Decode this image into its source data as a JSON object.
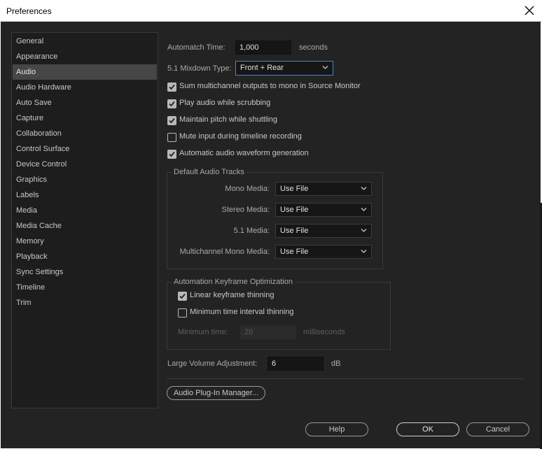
{
  "window": {
    "title": "Preferences"
  },
  "sidebar": {
    "items": [
      {
        "label": "General"
      },
      {
        "label": "Appearance"
      },
      {
        "label": "Audio",
        "selected": true
      },
      {
        "label": "Audio Hardware"
      },
      {
        "label": "Auto Save"
      },
      {
        "label": "Capture"
      },
      {
        "label": "Collaboration"
      },
      {
        "label": "Control Surface"
      },
      {
        "label": "Device Control"
      },
      {
        "label": "Graphics"
      },
      {
        "label": "Labels"
      },
      {
        "label": "Media"
      },
      {
        "label": "Media Cache"
      },
      {
        "label": "Memory"
      },
      {
        "label": "Playback"
      },
      {
        "label": "Sync Settings"
      },
      {
        "label": "Timeline"
      },
      {
        "label": "Trim"
      }
    ]
  },
  "audio": {
    "automatch": {
      "label": "Automatch Time:",
      "value": "1,000",
      "unit": "seconds"
    },
    "mixdown": {
      "label": "5.1 Mixdown Type:",
      "value": "Front + Rear"
    },
    "checkboxes": [
      {
        "label": "Sum multichannel outputs to mono in Source Monitor",
        "checked": true
      },
      {
        "label": "Play audio while scrubbing",
        "checked": true
      },
      {
        "label": "Maintain pitch while shuttling",
        "checked": true
      },
      {
        "label": "Mute input during timeline recording",
        "checked": false
      },
      {
        "label": "Automatic audio waveform generation",
        "checked": true
      }
    ],
    "default_tracks": {
      "title": "Default Audio Tracks",
      "rows": [
        {
          "label": "Mono Media:",
          "value": "Use File"
        },
        {
          "label": "Stereo Media:",
          "value": "Use File"
        },
        {
          "label": "5.1 Media:",
          "value": "Use File"
        },
        {
          "label": "Multichannel Mono Media:",
          "value": "Use File"
        }
      ]
    },
    "keyframe": {
      "title": "Automation Keyframe Optimization",
      "linear": {
        "label": "Linear keyframe thinning",
        "checked": true
      },
      "min_interval": {
        "label": "Minimum time interval thinning",
        "checked": false
      },
      "min_time": {
        "label": "Minimum time:",
        "value": "20",
        "unit": "milliseconds"
      }
    },
    "large_volume": {
      "label": "Large Volume Adjustment:",
      "value": "6",
      "unit": "dB"
    },
    "plugin_button": "Audio Plug-In Manager..."
  },
  "footer": {
    "help": "Help",
    "ok": "OK",
    "cancel": "Cancel"
  },
  "colors": {
    "background": "#232323",
    "sidebar": "#1d1d1d",
    "selected": "#464646",
    "focus": "#2d8ceb"
  }
}
